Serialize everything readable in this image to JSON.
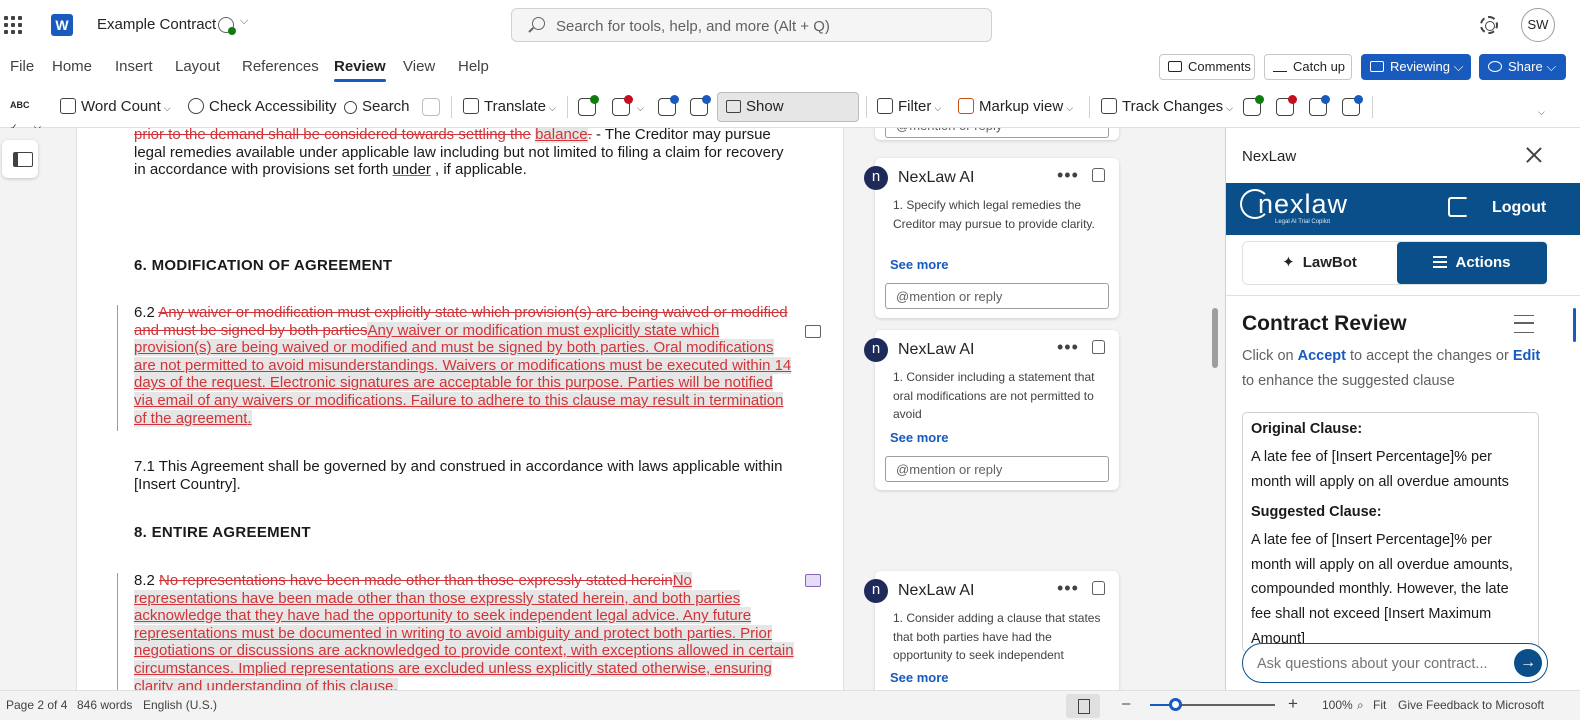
{
  "app": {
    "doc_title": "Example Contract",
    "search_placeholder": "Search for tools, help, and more (Alt + Q)",
    "user_initials": "SW",
    "brand_color": "#185abd"
  },
  "menu": {
    "items": [
      "File",
      "Home",
      "Insert",
      "Layout",
      "References",
      "Review",
      "View",
      "Help"
    ],
    "active": "Review",
    "comments_btn": "Comments",
    "catchup_btn": "Catch up",
    "reviewing_btn": "Reviewing",
    "share_btn": "Share"
  },
  "ribbon": {
    "spelling_icon": "ABC",
    "word_count": "Word Count",
    "check_accessibility": "Check Accessibility",
    "search": "Search",
    "translate": "Translate",
    "show_comments": "Show Comments",
    "filter": "Filter",
    "markup_view": "Markup view",
    "track_changes": "Track Changes"
  },
  "document": {
    "p1_deleted": "prior to the demand shall be considered towards settling the",
    "p1_inserted": "balance",
    "p1_del_end": ".",
    "p1_rest_a": " - The Creditor may pursue legal remedies available under applicable law including but not limited to filing a claim for recovery in accordance with provisions set forth ",
    "p1_under": "under",
    "p1_rest_b": " , if applicable.",
    "h6": "6. MODIFICATION OF AGREEMENT",
    "s62_num": "6.2 ",
    "s62_deleted": "Any waiver or modification must explicitly state which provision(s) are being waived or modified and must be signed by both parties",
    "s62_inserted": "Any waiver or modification must explicitly state which provision(s) are being waived or modified and must be signed by both parties. Oral modifications are not permitted to avoid misunderstandings. Waivers or modifications must be executed within 14 days of the request. Electronic signatures are acceptable for this purpose. Parties will be notified via email of any waivers or modifications. Failure to adhere to this clause may result in termination of the agreement",
    "s62_end": ".",
    "s71": "7.1 This Agreement shall be governed by and construed in accordance with laws applicable within [Insert Country].",
    "h8": "8. ENTIRE AGREEMENT",
    "s82_num": "8.2 ",
    "s82_deleted": "No representations have been made other than those expressly stated herein",
    "s82_inserted": "No representations have been made other than those expressly stated herein, and both parties acknowledge that they have had the opportunity to seek independent legal advice. Any future representations must be documented in writing to avoid ambiguity and protect both parties. Prior negotiations or discussions are acknowledged to provide context, with exceptions allowed in certain circumstances. Implied representations are excluded unless explicitly stated otherwise, ensuring clarity and understanding of this clause."
  },
  "comments": {
    "reply_placeholder": "@mention or reply",
    "see_more": "See more",
    "items": [
      {
        "author": "NexLaw AI",
        "avatar": "n",
        "text": "1. Specify which legal remedies the Creditor may pursue to provide clarity."
      },
      {
        "author": "NexLaw AI",
        "avatar": "n",
        "text": "1. Consider including a statement that oral modifications are not permitted to avoid"
      },
      {
        "author": "NexLaw AI",
        "avatar": "n",
        "text": "1. Consider adding a clause that states that both parties have had the opportunity to seek independent"
      }
    ]
  },
  "nexlaw": {
    "panel_title": "NexLaw",
    "logo": "nexlaw",
    "tagline": "Legal AI Trial Copilot",
    "logout": "Logout",
    "tab_lawbot": "LawBot",
    "tab_actions": "Actions",
    "section_title": "Contract Review",
    "desc_pre": "Click on ",
    "desc_accept": "Accept",
    "desc_mid": " to accept the changes or ",
    "desc_edit": "Edit",
    "desc_post": " to enhance the suggested clause",
    "original_label": "Original Clause:",
    "original_text": "A late fee of [Insert Percentage]% per month will apply on all overdue amounts",
    "suggested_label": "Suggested Clause:",
    "suggested_text": "A late fee of [Insert Percentage]% per month will apply on all overdue amounts, compounded monthly. However, the late fee shall not exceed [Insert Maximum Amount]",
    "ask_placeholder": "Ask questions about your contract...",
    "accent": "#0b4f8a"
  },
  "status": {
    "page": "Page 2 of 4",
    "words": "846 words",
    "language": "English (U.S.)",
    "zoom": "100%",
    "zoom_level": 0.2,
    "fit": "Fit",
    "feedback": "Give Feedback to Microsoft"
  }
}
